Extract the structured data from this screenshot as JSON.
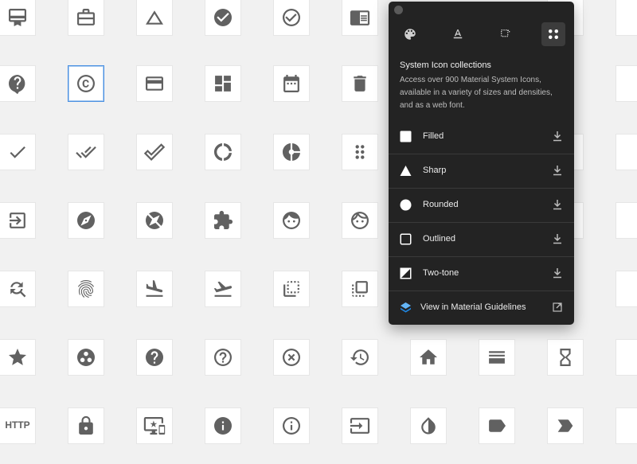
{
  "background_color": "#f1f1f1",
  "grid_tiles": [
    {
      "icon": "card-membership-icon"
    },
    {
      "icon": "work-icon"
    },
    {
      "icon": "change-history-icon"
    },
    {
      "icon": "check-circle-icon"
    },
    {
      "icon": "check-circle-outline-icon"
    },
    {
      "icon": "chrome-reader-mode-icon"
    },
    {
      "icon": "live-help-icon"
    },
    {
      "icon": "copyright-icon",
      "selected": true
    },
    {
      "icon": "credit-card-icon"
    },
    {
      "icon": "dashboard-icon"
    },
    {
      "icon": "date-range-icon"
    },
    {
      "icon": "delete-icon"
    },
    {
      "icon": "done-icon"
    },
    {
      "icon": "done-all-icon"
    },
    {
      "icon": "done-outline-icon"
    },
    {
      "icon": "donut-large-icon"
    },
    {
      "icon": "donut-small-icon"
    },
    {
      "icon": "drag-indicator-icon"
    },
    {
      "icon": "exit-to-app-icon"
    },
    {
      "icon": "explore-icon"
    },
    {
      "icon": "explore-off-icon"
    },
    {
      "icon": "extension-icon"
    },
    {
      "icon": "face-icon"
    },
    {
      "icon": "face-outline-icon"
    },
    {
      "icon": "find-replace-icon"
    },
    {
      "icon": "fingerprint-icon"
    },
    {
      "icon": "flight-land-icon"
    },
    {
      "icon": "flight-takeoff-icon"
    },
    {
      "icon": "flip-to-back-icon"
    },
    {
      "icon": "flip-to-front-icon"
    },
    {
      "icon": "grade-icon"
    },
    {
      "icon": "group-work-icon"
    },
    {
      "icon": "help-icon"
    },
    {
      "icon": "help-outline-icon"
    },
    {
      "icon": "highlight-off-icon"
    },
    {
      "icon": "history-icon"
    },
    {
      "icon": "home-icon"
    },
    {
      "icon": "horizontal-split-icon"
    },
    {
      "icon": "hourglass-empty-icon"
    },
    {
      "icon": "http-icon",
      "text": "HTTP"
    },
    {
      "icon": "https-icon"
    },
    {
      "icon": "important-devices-icon"
    },
    {
      "icon": "info-icon"
    },
    {
      "icon": "info-outline-icon"
    },
    {
      "icon": "input-icon"
    },
    {
      "icon": "invert-colors-icon"
    },
    {
      "icon": "label-icon"
    },
    {
      "icon": "label-important-icon"
    }
  ],
  "panel": {
    "tabs": [
      {
        "icon": "palette-icon",
        "active": false
      },
      {
        "icon": "text-format-icon",
        "active": false
      },
      {
        "icon": "crop-icon",
        "active": false
      },
      {
        "icon": "icon-grid-icon",
        "active": true
      }
    ],
    "heading": "System Icon collections",
    "description": "Access over 900 Material System Icons, available in a variety of sizes and densities, and as a web font.",
    "styles": [
      {
        "label": "Filled",
        "icon": "square-filled-icon"
      },
      {
        "label": "Sharp",
        "icon": "triangle-icon"
      },
      {
        "label": "Rounded",
        "icon": "circle-icon"
      },
      {
        "label": "Outlined",
        "icon": "square-outline-icon"
      },
      {
        "label": "Two-tone",
        "icon": "two-tone-icon"
      }
    ],
    "guidelines_link": "View in Material Guidelines",
    "accent_color": "#4a9ff5"
  }
}
